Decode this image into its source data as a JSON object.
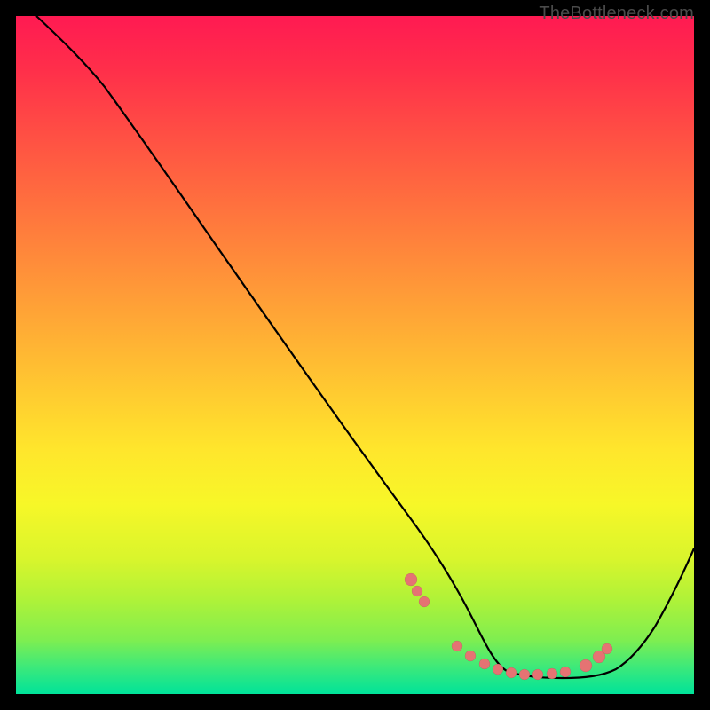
{
  "watermark": "TheBottleneck.com",
  "colors": {
    "bg": "#000000",
    "curve": "#000000",
    "dots": "#e57373"
  },
  "chart_data": {
    "type": "line",
    "title": "",
    "xlabel": "",
    "ylabel": "",
    "xlim": [
      0,
      100
    ],
    "ylim": [
      0,
      100
    ],
    "grid": false,
    "legend": false,
    "description": "V-shaped bottleneck curve over vertical rainbow gradient (red top to green bottom). Asymmetric V with flat trough between x≈65 and x≈85; minimum near y≈3.",
    "series": [
      {
        "name": "curve",
        "x": [
          3,
          6,
          10,
          15,
          20,
          25,
          30,
          35,
          40,
          45,
          50,
          55,
          58,
          61,
          64,
          67,
          70,
          73,
          76,
          79,
          82,
          85,
          88,
          91,
          94,
          97,
          100
        ],
        "y": [
          100,
          98,
          95,
          90,
          83,
          76,
          69,
          61,
          53,
          45,
          37,
          28,
          22,
          16,
          10,
          6,
          4,
          3,
          3,
          3,
          3,
          4,
          6,
          9,
          13,
          18,
          24
        ]
      }
    ],
    "scatter": {
      "name": "trough-dots",
      "x": [
        58,
        59,
        60,
        65,
        67,
        69,
        71,
        73,
        75,
        77,
        79,
        81,
        84,
        86,
        87
      ],
      "y": [
        17,
        15,
        13,
        5,
        4.2,
        3.6,
        3.2,
        3,
        3,
        3,
        3.2,
        3.4,
        4,
        5,
        5.8
      ]
    }
  }
}
